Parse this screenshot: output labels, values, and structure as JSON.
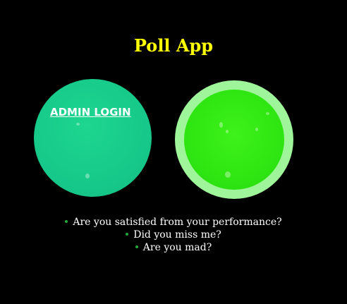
{
  "header": {
    "title": "Poll App"
  },
  "admin": {
    "login_label": "ADMIN LOGIN"
  },
  "questions": [
    "Are you satisfied from your performance?",
    "Did you miss me?",
    "Are you mad?"
  ],
  "colors": {
    "background": "#000000",
    "title": "#ffff00",
    "admin_circle": "#16c98a",
    "user_circle": "#2fe612",
    "user_circle_ring": "#9ff59a",
    "bullet": "#22a83a"
  }
}
